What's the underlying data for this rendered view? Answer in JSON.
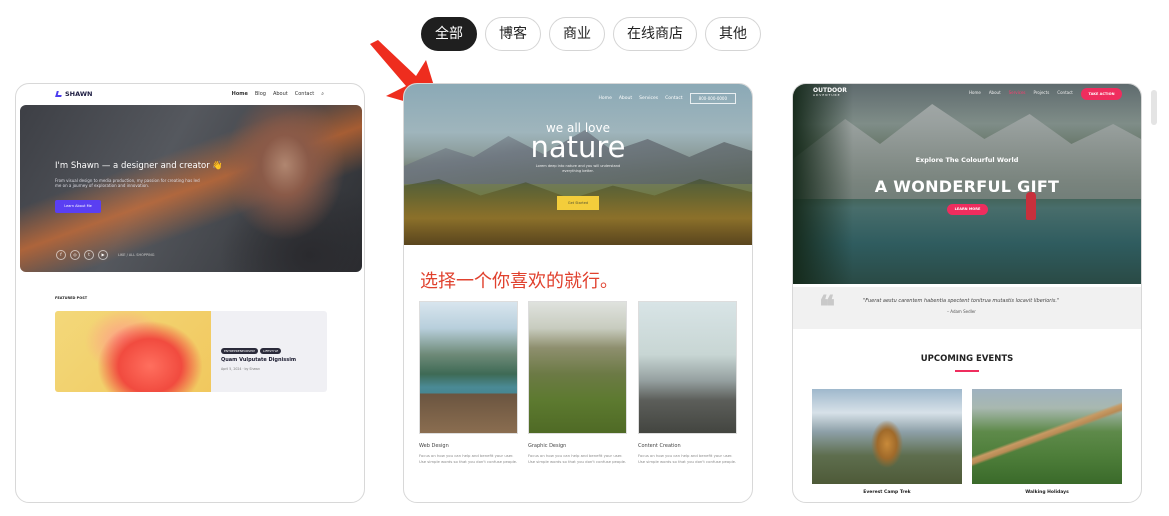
{
  "filters": [
    "全部",
    "博客",
    "商业",
    "在线商店",
    "其他"
  ],
  "active_filter": "全部",
  "card1": {
    "logo": "SHAWN",
    "nav": [
      "Home",
      "Blog",
      "About",
      "Contact"
    ],
    "hero_title": "I'm Shawn — a designer and creator 👋",
    "hero_sub": "From visual design to media production, my passion for creating has led me on a journey of exploration and innovation.",
    "hero_button": "Learn About Me",
    "social_text": "LIKE / ALL SHOPPING",
    "featured_label": "FEATURED POST",
    "tags": [
      "ENTREPRENEURSHIP",
      "LIFESTYLE"
    ],
    "post_title": "Quam Vulputate Dignissim",
    "post_meta": "April 5, 2024 · by Shawn"
  },
  "card2": {
    "nav": [
      "Home",
      "About",
      "Services",
      "Contact"
    ],
    "phone": "800-000-0000",
    "hero_small": "we all love",
    "hero_big": "nature",
    "hero_sub": "Lorem deep into nature and you will understand everything better.",
    "hero_button": "Get Started",
    "heading": "选择一个你喜欢的就行。",
    "columns": [
      {
        "caption": "Web Design",
        "desc": "Focus on how you can help and benefit your user. Use simple words so that you don't confuse people."
      },
      {
        "caption": "Graphic Design",
        "desc": "Focus on how you can help and benefit your user. Use simple words so that you don't confuse people."
      },
      {
        "caption": "Content Creation",
        "desc": "Focus on how you can help and benefit your user. Use simple words so that you don't confuse people."
      }
    ]
  },
  "card3": {
    "logo": "OUTDOOR",
    "logo_sub": "ADVENTURE",
    "nav": [
      "Home",
      "About",
      "Services",
      "Projects",
      "Contact"
    ],
    "cta": "TAKE ACTION",
    "kicker": "Explore The Colourful World",
    "title": "A WONDERFUL GIFT",
    "learn": "LEARN MORE",
    "quote": "\"Fuerat aestu carentem habentia spectent tonitrua mutastis locavit liberioris.\"",
    "author": "– Adam Sedler",
    "events_title": "UPCOMING EVENTS",
    "events": [
      "Everest Camp Trek",
      "Walking Holidays"
    ]
  },
  "colors": {
    "accent_red": "#e0412e",
    "active_chip": "#1f1f1f",
    "pink": "#ef2d5e",
    "purple": "#5a3ff2",
    "yellow": "#f3cd3b"
  }
}
